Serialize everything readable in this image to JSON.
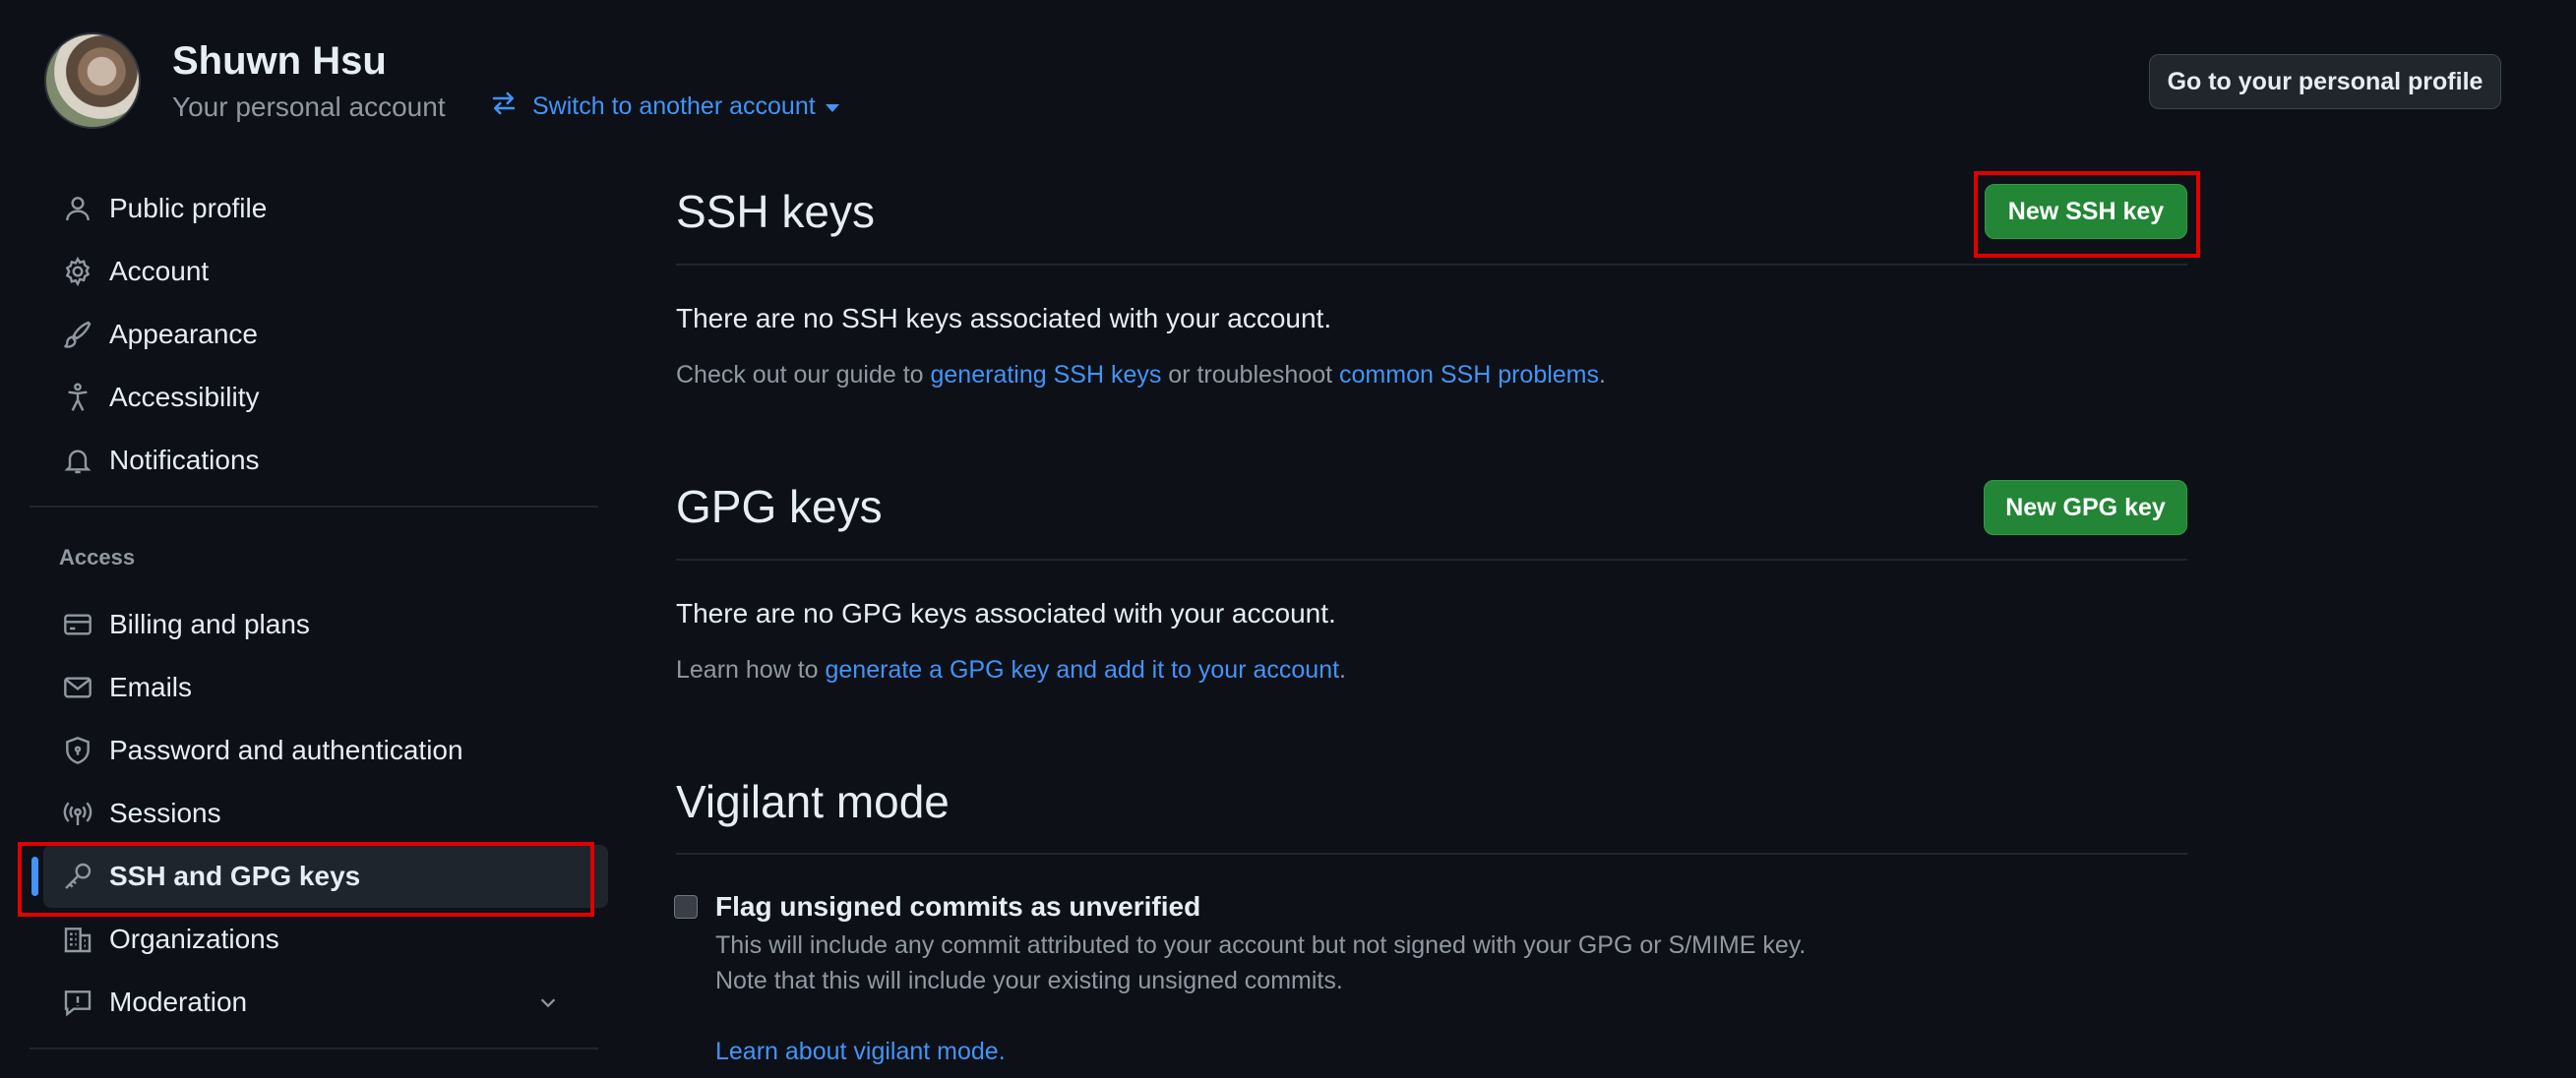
{
  "header": {
    "user_name": "Shuwn Hsu",
    "account_type": "Your personal account",
    "switch_label": "Switch to another account",
    "profile_button": "Go to your personal profile"
  },
  "sidebar": {
    "items_top": [
      {
        "label": "Public profile",
        "icon": "person-icon"
      },
      {
        "label": "Account",
        "icon": "gear-icon"
      },
      {
        "label": "Appearance",
        "icon": "paintbrush-icon"
      },
      {
        "label": "Accessibility",
        "icon": "accessibility-icon"
      },
      {
        "label": "Notifications",
        "icon": "bell-icon"
      }
    ],
    "access_label": "Access",
    "items_access": [
      {
        "label": "Billing and plans",
        "icon": "credit-card-icon"
      },
      {
        "label": "Emails",
        "icon": "mail-icon"
      },
      {
        "label": "Password and authentication",
        "icon": "shield-icon"
      },
      {
        "label": "Sessions",
        "icon": "broadcast-icon"
      },
      {
        "label": "SSH and GPG keys",
        "icon": "key-icon",
        "active": true
      },
      {
        "label": "Organizations",
        "icon": "organization-icon"
      },
      {
        "label": "Moderation",
        "icon": "report-icon"
      }
    ]
  },
  "ssh": {
    "title": "SSH keys",
    "button": "New SSH key",
    "empty": "There are no SSH keys associated with your account.",
    "guide_prefix": "Check out our guide to ",
    "guide_link": "generating SSH keys",
    "guide_mid": " or troubleshoot ",
    "guide_link2": "common SSH problems",
    "guide_suffix": "."
  },
  "gpg": {
    "title": "GPG keys",
    "button": "New GPG key",
    "empty": "There are no GPG keys associated with your account.",
    "learn_prefix": "Learn how to ",
    "learn_link": "generate a GPG key and add it to your account",
    "learn_suffix": "."
  },
  "vigilant": {
    "title": "Vigilant mode",
    "checkbox_label": "Flag unsigned commits as unverified",
    "checked": false,
    "desc1": "This will include any commit attributed to your account but not signed with your GPG or S/MIME key.",
    "desc2": "Note that this will include your existing unsigned commits.",
    "learn_link": "Learn about vigilant mode."
  },
  "colors": {
    "background": "#0d1117",
    "link": "#4493f8",
    "green_button": "#238636",
    "highlight_box": "#e00000"
  }
}
